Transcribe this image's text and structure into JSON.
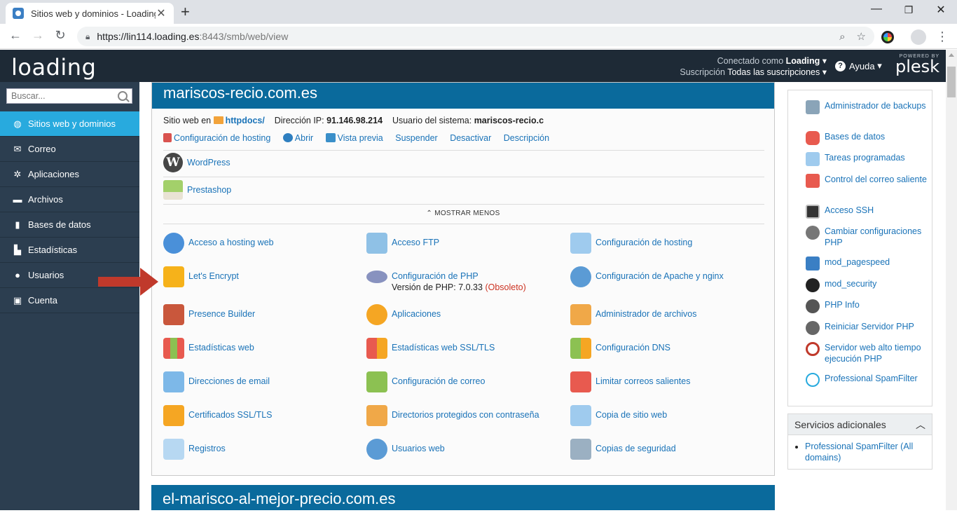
{
  "browser": {
    "tab_title": "Sitios web y dominios - Loading",
    "url_main": "https://lin114.loading.es",
    "url_rest": ":8443/smb/web/view"
  },
  "header": {
    "logo": "loading",
    "connected_label": "Conectado como",
    "connected_user": "Loading",
    "subscription_label": "Suscripción",
    "subscription_value": "Todas las suscripciones",
    "help": "Ayuda",
    "powered_by": "POWERED BY",
    "plesk": "plesk"
  },
  "sidebar": {
    "search_placeholder": "Buscar...",
    "items": [
      {
        "label": "Sitios web y dominios"
      },
      {
        "label": "Correo"
      },
      {
        "label": "Aplicaciones"
      },
      {
        "label": "Archivos"
      },
      {
        "label": "Bases de datos"
      },
      {
        "label": "Estadísticas"
      },
      {
        "label": "Usuarios"
      },
      {
        "label": "Cuenta"
      }
    ]
  },
  "domain": {
    "name": "mariscos-recio.com.es",
    "site_label": "Sitio web en",
    "site_folder": "httpdocs/",
    "ip_label": "Dirección IP:",
    "ip": "91.146.98.214",
    "sysuser_label": "Usuario del sistema:",
    "sysuser": "mariscos-recio.c",
    "actions": [
      "Configuración de hosting",
      "Abrir",
      "Vista previa",
      "Suspender",
      "Desactivar",
      "Descripción"
    ],
    "apps": [
      "WordPress",
      "Prestashop"
    ],
    "show_less": "MOSTRAR MENOS",
    "tools": [
      [
        "Acceso a hosting web",
        "Acceso FTP",
        "Configuración de hosting"
      ],
      [
        "Let's Encrypt",
        "Configuración de PHP",
        "Configuración de Apache y nginx"
      ],
      [
        "Presence Builder",
        "Aplicaciones",
        "Administrador de archivos"
      ],
      [
        "Estadísticas web",
        "Estadísticas web SSL/TLS",
        "Configuración DNS"
      ],
      [
        "Direcciones de email",
        "Configuración de correo",
        "Limitar correos salientes"
      ],
      [
        "Certificados SSL/TLS",
        "Directorios protegidos con contraseña",
        "Copia de sitio web"
      ],
      [
        "Registros",
        "Usuarios web",
        "Copias de seguridad"
      ]
    ],
    "php_version_label": "Versión de PHP: 7.0.33",
    "php_obsolete": "(Obsoleto)"
  },
  "right_panel": {
    "items": [
      "Administrador de backups",
      "Bases de datos",
      "Tareas programadas",
      "Control del correo saliente",
      "Acceso SSH",
      "Cambiar configuraciones PHP",
      "mod_pagespeed",
      "mod_security",
      "PHP Info",
      "Reiniciar Servidor PHP",
      "Servidor web alto tiempo ejecución PHP",
      "Professional SpamFilter"
    ]
  },
  "services": {
    "title": "Servicios adicionales",
    "item": "Professional SpamFilter (All domains)"
  },
  "domain2": {
    "name": "el-marisco-al-mejor-precio.com.es"
  }
}
